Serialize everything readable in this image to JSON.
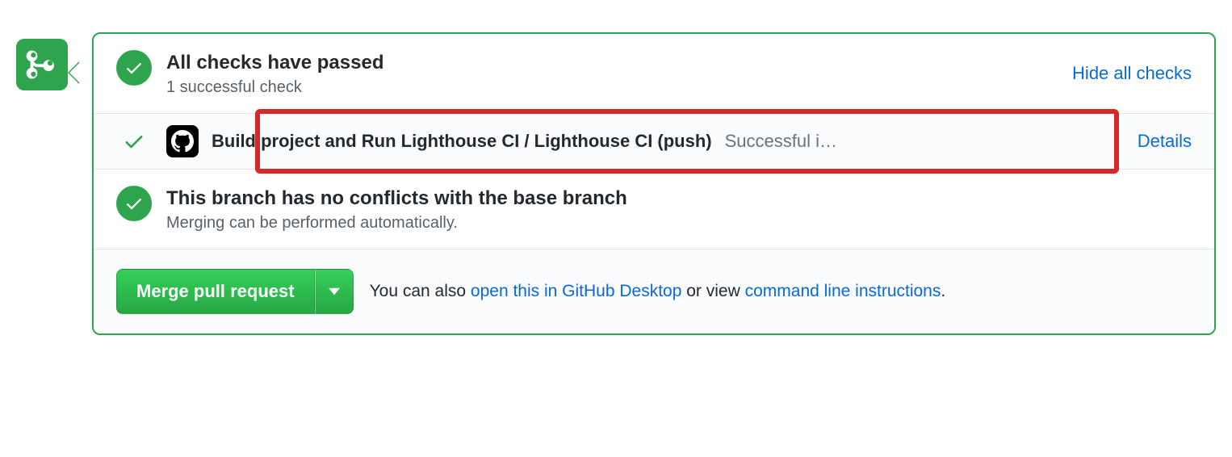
{
  "checks_summary": {
    "title": "All checks have passed",
    "subtitle": "1 successful check",
    "toggle_label": "Hide all checks"
  },
  "checks": [
    {
      "name": "Build project and Run Lighthouse CI / Lighthouse CI (push)",
      "result": "Successful i…",
      "details_label": "Details"
    }
  ],
  "conflicts": {
    "title": "This branch has no conflicts with the base branch",
    "subtitle": "Merging can be performed automatically."
  },
  "merge": {
    "button_label": "Merge pull request",
    "help_prefix": "You can also ",
    "desktop_link": "open this in GitHub Desktop",
    "help_mid": " or view ",
    "cli_link": "command line instructions",
    "help_suffix": "."
  }
}
